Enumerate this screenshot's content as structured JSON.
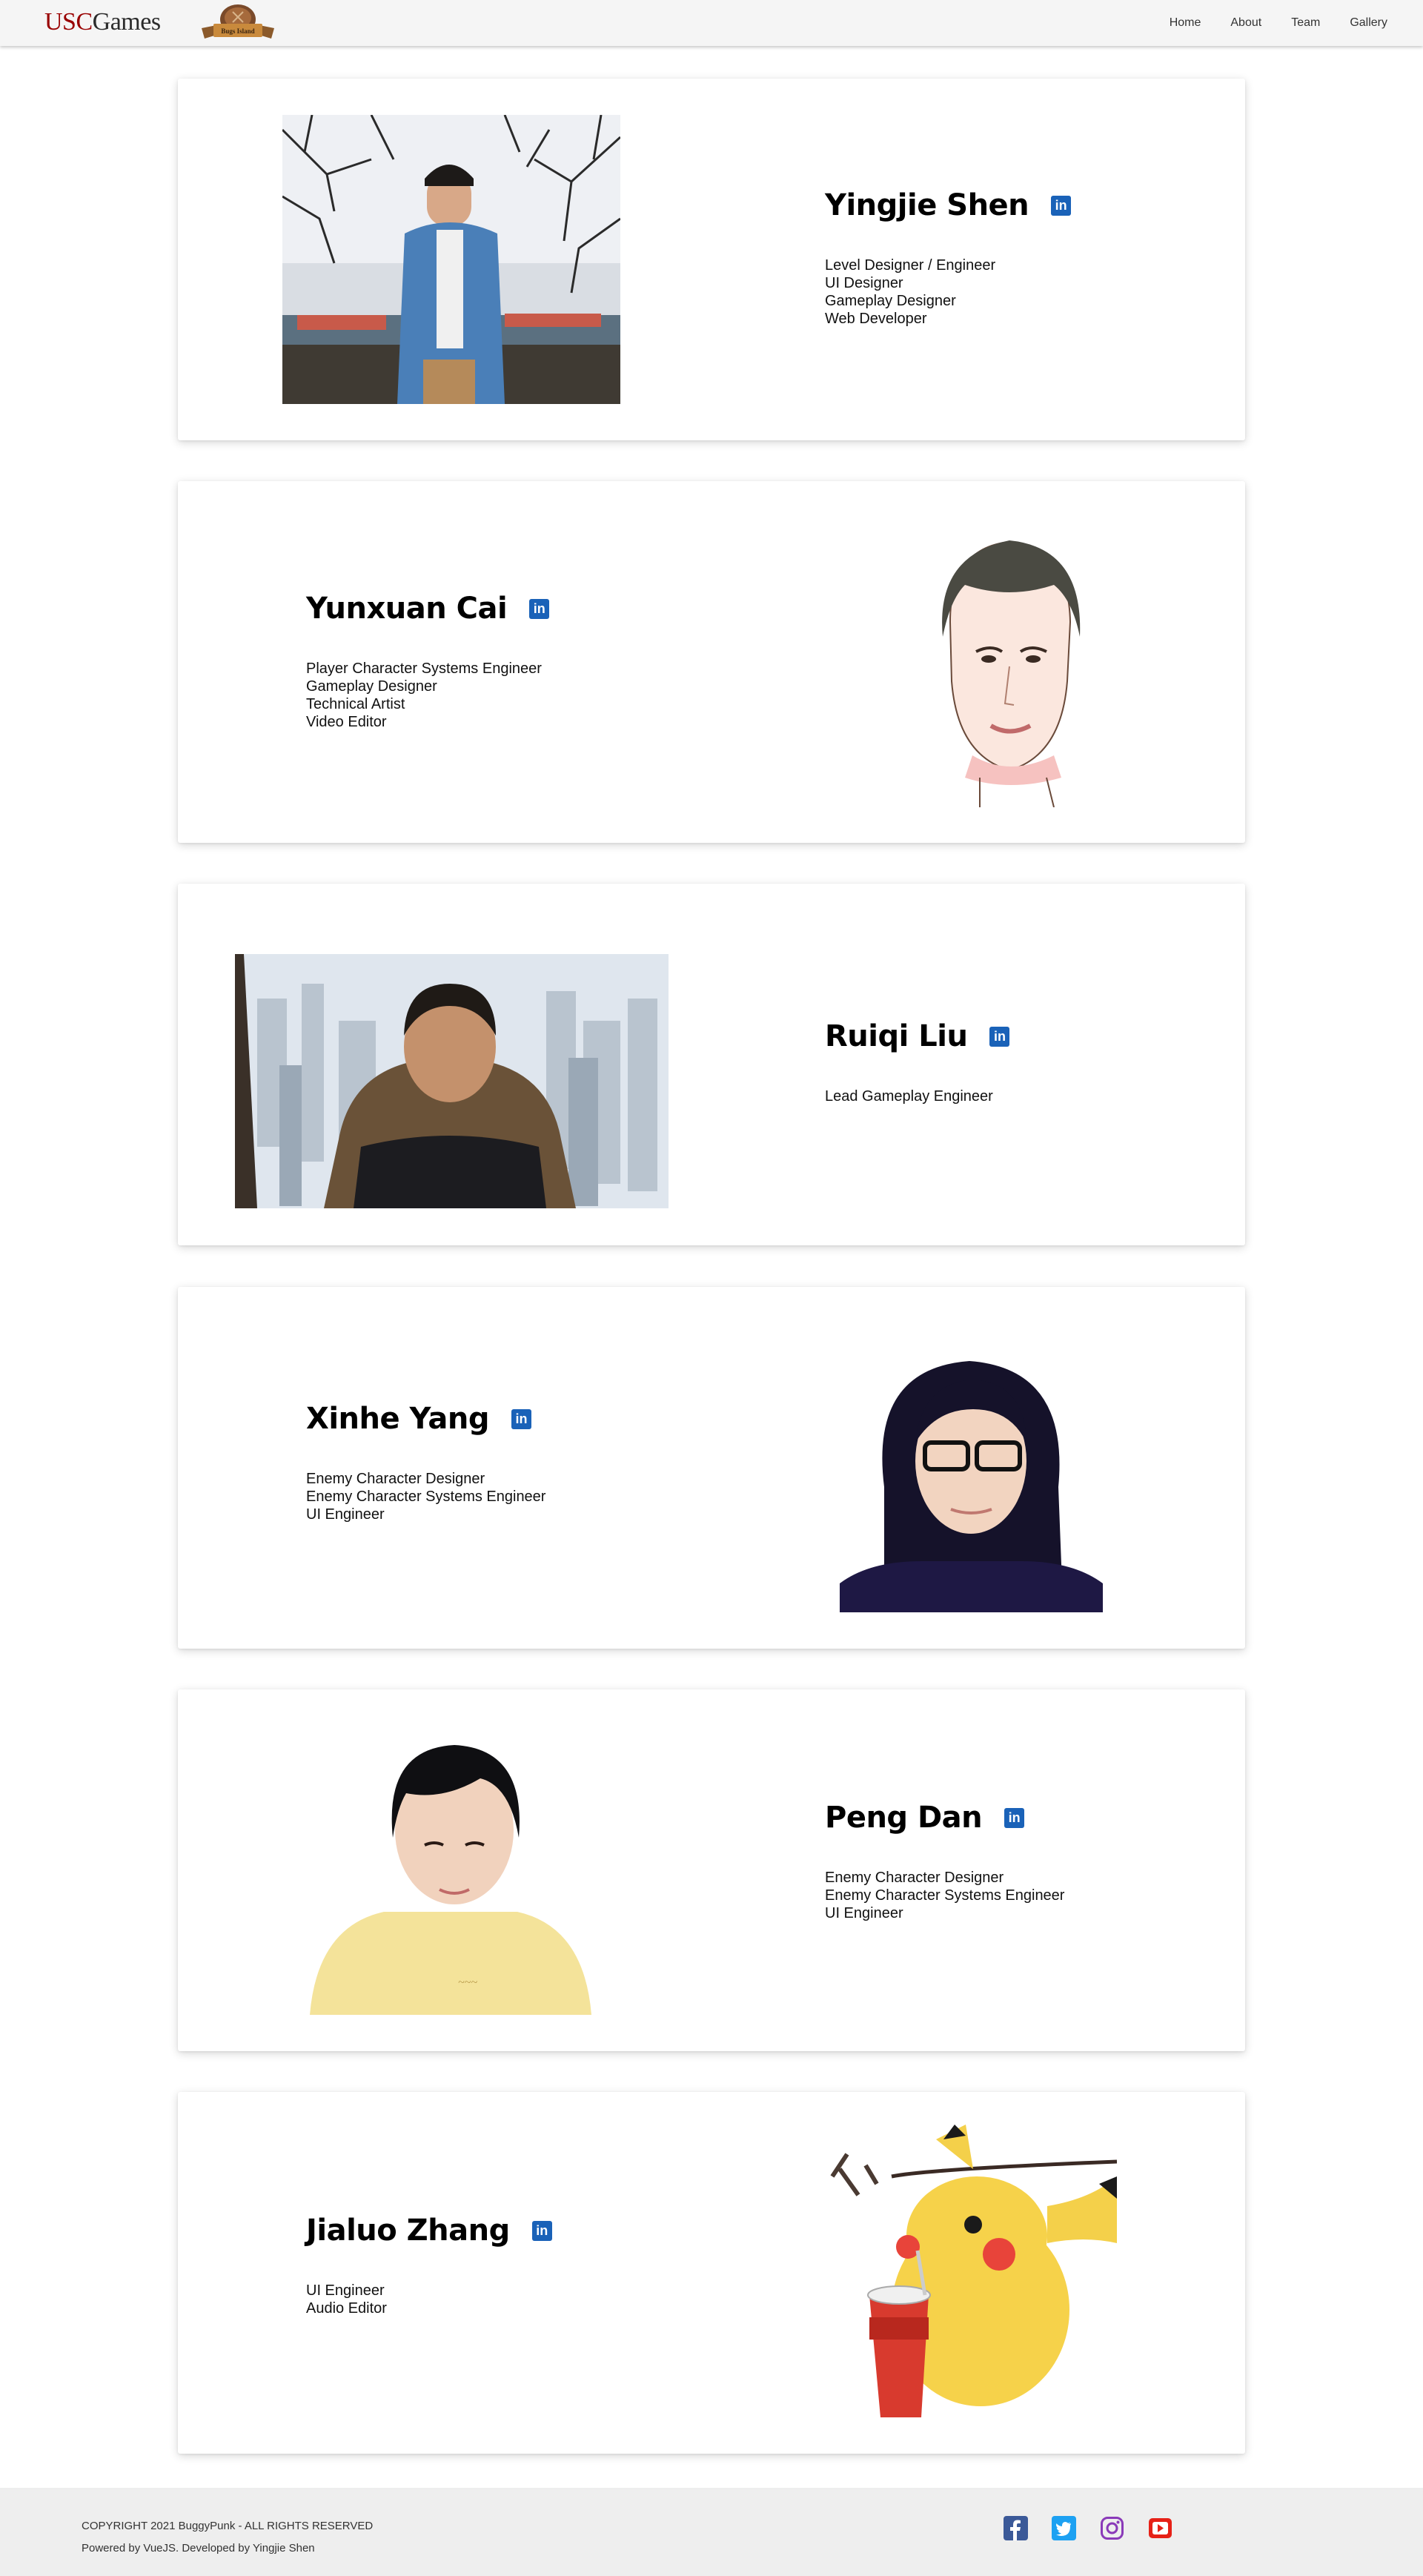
{
  "header": {
    "brand_usc": "USC",
    "brand_games": "Games",
    "logo_text": "Bugs Island",
    "nav": [
      "Home",
      "About",
      "Team",
      "Gallery"
    ]
  },
  "members": [
    {
      "name": "Yingjie Shen",
      "roles": [
        "Level Designer / Engineer",
        "UI Designer",
        "Gameplay Designer",
        "Web Developer"
      ],
      "linkedin": "in"
    },
    {
      "name": "Yunxuan Cai",
      "roles": [
        "Player Character Systems Engineer",
        "Gameplay Designer",
        "Technical Artist",
        "Video Editor"
      ],
      "linkedin": "in"
    },
    {
      "name": "Ruiqi Liu",
      "roles": [
        "Lead Gameplay Engineer"
      ],
      "linkedin": "in"
    },
    {
      "name": "Xinhe Yang",
      "roles": [
        "Enemy Character Designer",
        "Enemy Character Systems Engineer",
        "UI Engineer"
      ],
      "linkedin": "in"
    },
    {
      "name": "Peng Dan",
      "roles": [
        "Enemy Character Designer",
        "Enemy Character Systems Engineer",
        "UI Engineer"
      ],
      "linkedin": "in"
    },
    {
      "name": "Jialuo Zhang",
      "roles": [
        "UI Engineer",
        "Audio Editor"
      ],
      "linkedin": "in"
    }
  ],
  "footer": {
    "copyright": "COPYRIGHT 2021 BuggyPunk - ALL RIGHTS RESERVED",
    "powered": "Powered by VueJS. Developed by Yingjie Shen"
  },
  "socials": [
    {
      "icon": "facebook-icon",
      "color": "#3b5998"
    },
    {
      "icon": "twitter-icon",
      "color": "#1da1f2"
    },
    {
      "icon": "instagram-icon",
      "color": "#8a3ab9"
    },
    {
      "icon": "youtube-icon",
      "color": "#e62117"
    }
  ],
  "colors": {
    "usc_red": "#990000",
    "linkedin_blue": "#1a62b8",
    "footer_bg": "#eeeeee",
    "header_bg": "#f5f5f5"
  }
}
